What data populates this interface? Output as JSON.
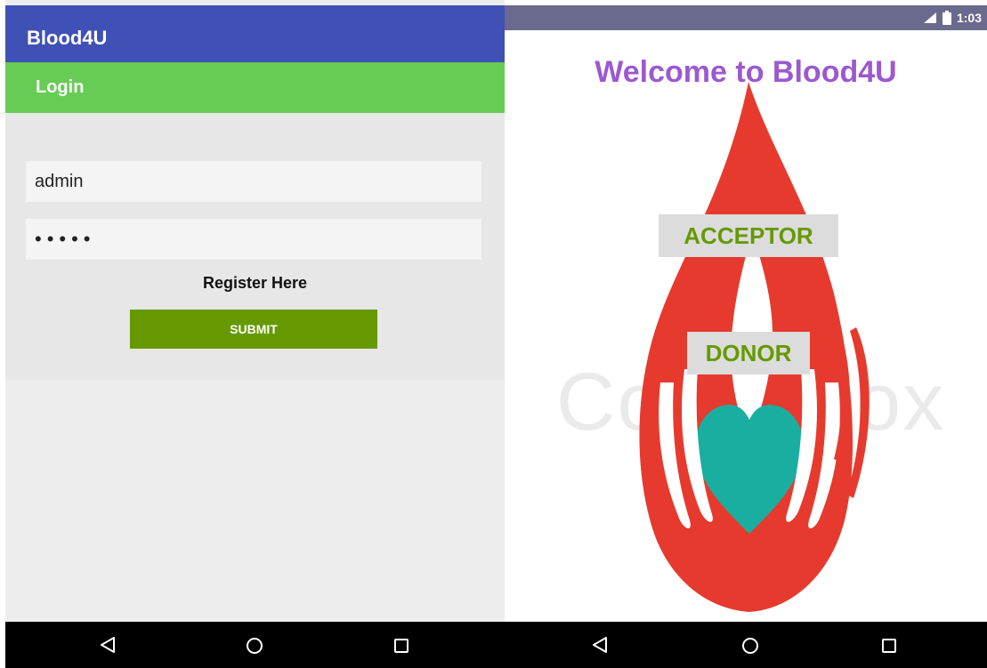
{
  "login_screen": {
    "app_title": "Blood4U",
    "tab_label": "Login",
    "username_value": "admin",
    "password_value": "•••••",
    "register_link": "Register Here",
    "submit_label": "SUBMIT"
  },
  "welcome_screen": {
    "status_time": "1:03",
    "welcome_text": "Welcome to Blood4U",
    "watermark_text": "Colourbox",
    "acceptor_label": "ACCEPTOR",
    "donor_label": "DONOR"
  },
  "navbar": {
    "icons": [
      "back-icon",
      "home-icon",
      "recent-apps-icon"
    ]
  },
  "colors": {
    "appbar": "#3f51b5",
    "tabbar": "#66cc55",
    "submit": "#669900",
    "welcome_text": "#9b59d0",
    "drop_red": "#e63a2e",
    "heart_teal": "#1aaea0"
  }
}
